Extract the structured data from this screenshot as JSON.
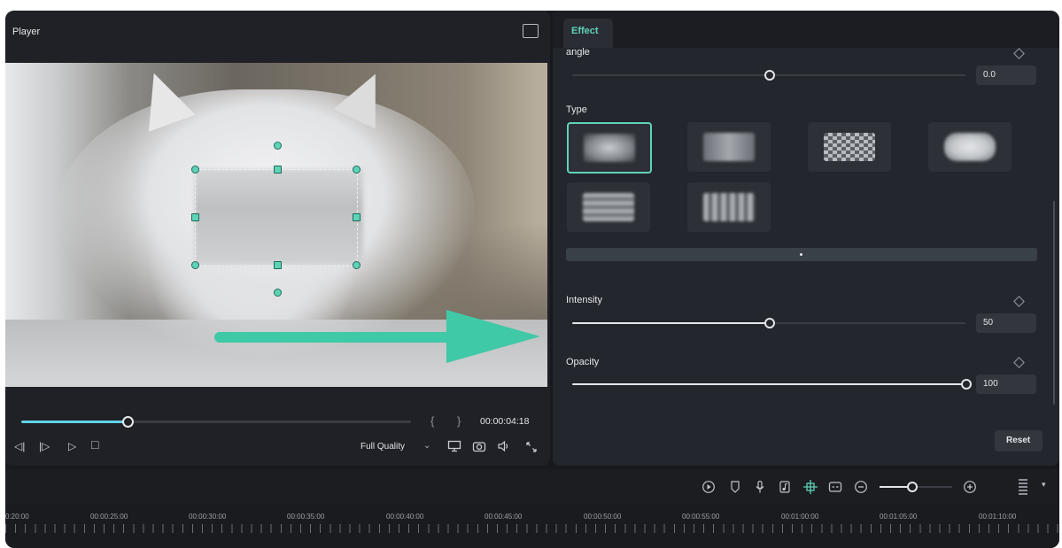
{
  "player": {
    "title": "Player",
    "header_icon": "image-icon",
    "progress": 0.27,
    "brace_open": "{",
    "brace_close": "}",
    "timecode": "00:00:04:18",
    "controls": {
      "prev_frame": "◁|",
      "next_frame": "|▷",
      "play": "▷",
      "stop": "□"
    },
    "quality": "Full Quality",
    "quality_chevron": "⌄",
    "right_icons": [
      "display-icon",
      "camera-icon",
      "volume-icon",
      "fullscreen-icon"
    ]
  },
  "effect": {
    "tab_label": "Effect",
    "angle": {
      "label": "angle",
      "value": "0.0",
      "level": 0.5
    },
    "type": {
      "label": "Type",
      "tiles": [
        {
          "name": "blur-type-gaussian",
          "active": true
        },
        {
          "name": "blur-type-box",
          "active": false
        },
        {
          "name": "blur-type-mosaic",
          "active": false
        },
        {
          "name": "blur-type-cloud",
          "active": false
        },
        {
          "name": "blur-type-horizontal",
          "active": false
        },
        {
          "name": "blur-type-vertical",
          "active": false
        }
      ]
    },
    "intensity": {
      "label": "Intensity",
      "value": "50",
      "level": 0.5
    },
    "opacity": {
      "label": "Opacity",
      "value": "100",
      "level": 1.0
    },
    "reset_label": "Reset"
  },
  "toolbar": {
    "icons": [
      "render-icon",
      "marker-icon",
      "microphone-icon",
      "audio-file-icon",
      "ai-effect-icon",
      "subtitle-icon",
      "zoom-out-icon",
      "zoom-in-icon",
      "grip-icon"
    ],
    "zoom_level": 0.44
  },
  "timeline": {
    "labels": [
      "0:20:00",
      "00:00:25:00",
      "00:00:30:00",
      "00:00:35:00",
      "00:00:40:00",
      "00:00:45:00",
      "00:00:50:00",
      "00:00:55:00",
      "00:01:00:00",
      "00:01:05:00",
      "00:01:10:00"
    ]
  }
}
